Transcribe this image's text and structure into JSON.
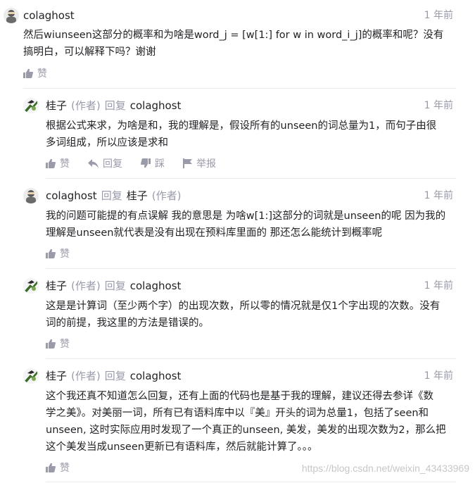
{
  "comments": [
    {
      "username": "colaghost",
      "time": "1 年前",
      "lines": [
        "然后wiunseen这部分的概率和为啥是word_j = [w[1:] for w in word_i_j]的概率和呢？没有",
        "搞明白，可以解释下吗？谢谢"
      ],
      "like": "赞"
    },
    {
      "username": "桂子",
      "author_tag": "(作者)",
      "reply_word": "回复",
      "reply_to": "colaghost",
      "time": "1 年前",
      "lines": [
        "根据公式来求，为啥是和，我的理解是，假设所有的unseen的词总量为1，而句子由很",
        "多词组成，所以应该是求和"
      ],
      "like": "赞",
      "reply": "回复",
      "dislike": "踩",
      "report": "举报"
    },
    {
      "username": "colaghost",
      "reply_word": "回复",
      "reply_to": "桂子",
      "reply_to_tag": "(作者)",
      "time": "1 年前",
      "lines": [
        "我的问题可能提的有点误解 我的意思是 为啥w[1:]这部分的词就是unseen的呢 因为我的",
        "理解是unseen就代表是没有出现在预料库里面的 那还怎么能统计到概率呢"
      ],
      "like": "赞"
    },
    {
      "username": "桂子",
      "author_tag": "(作者)",
      "reply_word": "回复",
      "reply_to": "colaghost",
      "time": "1 年前",
      "lines": [
        "这是是计算词（至少两个字）的出现次数，所以零的情况就是仅1个字出现的次数。没有",
        "词的前提，我这里的方法是错误的。"
      ],
      "like": "赞"
    },
    {
      "username": "桂子",
      "author_tag": "(作者)",
      "reply_word": "回复",
      "reply_to": "colaghost",
      "time": "1 年前",
      "lines": [
        "这个我还真不知道怎么回复，还有上面的代码也是基于我的理解，建议还得去参详《数",
        "学之美》。对美丽一词，所有已有语料库中以『美』开头的词为总量1，包括了seen和",
        "unseen, 这时实际应用时发现了一个真正的unseen, 美发，美发的出现次数为2，那么把",
        "这个美发当成unseen更新已有语料库，然后就能计算了。。。"
      ],
      "like": "赞"
    }
  ],
  "watermark": "https://blog.csdn.net/weixin_43433969",
  "colors": {
    "text": "#222226",
    "meta": "#999aaa",
    "divider": "#ebebeb"
  }
}
